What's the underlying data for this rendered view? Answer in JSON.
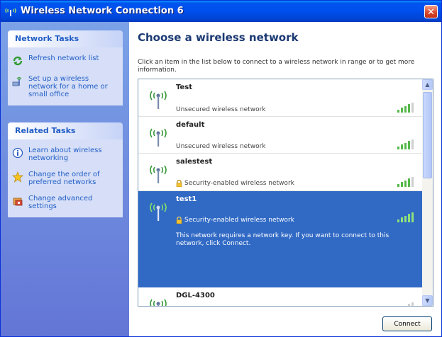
{
  "window": {
    "title": "Wireless Network Connection 6",
    "close_glyph": "✕"
  },
  "sidebar": {
    "network_tasks": {
      "header": "Network Tasks",
      "items": [
        {
          "label": "Refresh network list",
          "icon": "refresh-icon"
        },
        {
          "label": "Set up a wireless network for a home or small office",
          "icon": "setup-network-icon"
        }
      ]
    },
    "related_tasks": {
      "header": "Related Tasks",
      "items": [
        {
          "label": "Learn about wireless networking",
          "icon": "info-icon"
        },
        {
          "label": "Change the order of preferred networks",
          "icon": "star-icon"
        },
        {
          "label": "Change advanced settings",
          "icon": "settings-icon"
        }
      ]
    }
  },
  "main": {
    "title": "Choose a wireless network",
    "instructions": "Click an item in the list below to connect to a wireless network in range or to get more information.",
    "networks": [
      {
        "name": "Test",
        "status": "Unsecured wireless network",
        "secured": false,
        "selected": false,
        "signal_bars": 4
      },
      {
        "name": "default",
        "status": "Unsecured wireless network",
        "secured": false,
        "selected": false,
        "signal_bars": 4
      },
      {
        "name": "salestest",
        "status": "Security-enabled wireless network",
        "secured": true,
        "selected": false,
        "signal_bars": 4
      },
      {
        "name": "test1",
        "status": "Security-enabled wireless network",
        "secured": true,
        "selected": true,
        "signal_bars": 5,
        "description": "This network requires a network key. If you want to connect to this network, click Connect."
      },
      {
        "name": "DGL-4300",
        "status": "",
        "secured": false,
        "selected": false,
        "signal_bars": 2
      }
    ],
    "connect_label": "Connect"
  },
  "colors": {
    "title_bar": "#0053ee",
    "selected_row": "#316ac5",
    "sidebar": "#7ba2e7",
    "link": "#215dc6"
  }
}
